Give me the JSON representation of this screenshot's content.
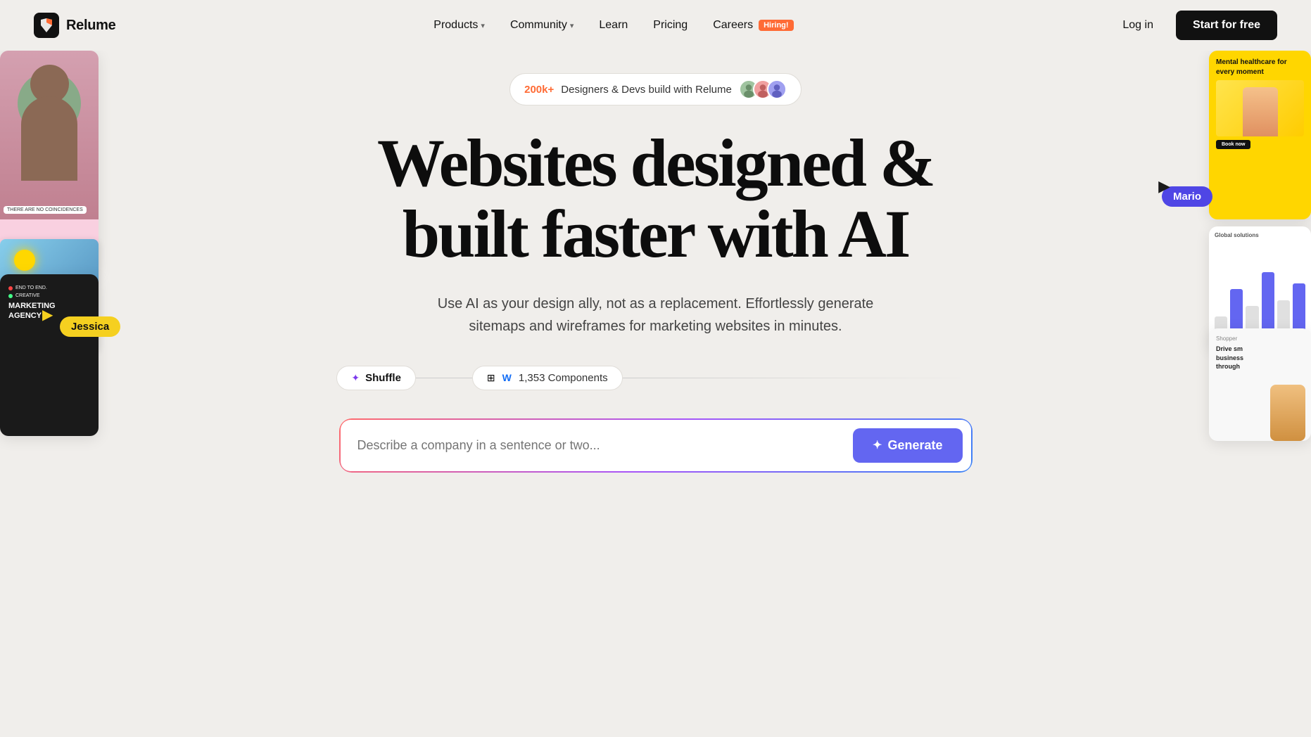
{
  "brand": {
    "name": "Relume",
    "logo_alt": "Relume Logo"
  },
  "navbar": {
    "links": [
      {
        "id": "products",
        "label": "Products",
        "has_dropdown": true
      },
      {
        "id": "community",
        "label": "Community",
        "has_dropdown": true
      },
      {
        "id": "learn",
        "label": "Learn",
        "has_dropdown": false
      },
      {
        "id": "pricing",
        "label": "Pricing",
        "has_dropdown": false
      },
      {
        "id": "careers",
        "label": "Careers",
        "has_dropdown": false,
        "badge": "Hiring!"
      }
    ],
    "login_label": "Log in",
    "start_label": "Start for free"
  },
  "hero": {
    "social_proof_count": "200k+",
    "social_proof_text": "Designers & Devs build with Relume",
    "heading_line1": "Websites designed &",
    "heading_line2": "built faster with AI",
    "subtext": "Use AI as your design ally, not as a replacement. Effortlessly generate sitemaps and wireframes for marketing websites in minutes.",
    "shuffle_label": "Shuffle",
    "components_count": "1,353 Components",
    "generate_placeholder": "Describe a company in a sentence or two...",
    "generate_btn_label": "Generate"
  },
  "cursors": {
    "jessica": {
      "label": "Jessica",
      "color": "#f5d020"
    },
    "mario": {
      "label": "Mario",
      "color": "#4f46e5"
    }
  },
  "right_card": {
    "mental_healthcare_text": "Mental healthcare for every moment"
  },
  "right_drive_card": {
    "text": "Drive sm business through"
  },
  "colors": {
    "accent_orange": "#ff6b35",
    "accent_purple": "#6366f1",
    "accent_yellow": "#f5d020",
    "bg": "#f0eeeb",
    "nav_bg": "#f0eeeb"
  }
}
